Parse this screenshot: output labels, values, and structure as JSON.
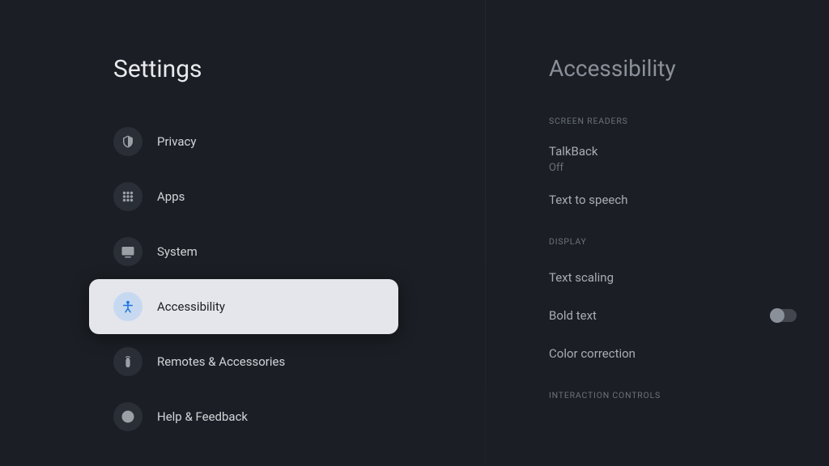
{
  "sidebar": {
    "title": "Settings",
    "items": [
      {
        "label": "Privacy",
        "icon": "shield",
        "selected": false
      },
      {
        "label": "Apps",
        "icon": "grid",
        "selected": false
      },
      {
        "label": "System",
        "icon": "monitor",
        "selected": false
      },
      {
        "label": "Accessibility",
        "icon": "accessibility",
        "selected": true
      },
      {
        "label": "Remotes & Accessories",
        "icon": "remote",
        "selected": false
      },
      {
        "label": "Help & Feedback",
        "icon": "help",
        "selected": false
      }
    ]
  },
  "panel": {
    "title": "Accessibility",
    "sections": [
      {
        "header": "SCREEN READERS",
        "items": [
          {
            "label": "TalkBack",
            "sublabel": "Off",
            "type": "link"
          },
          {
            "label": "Text to speech",
            "type": "link"
          }
        ]
      },
      {
        "header": "DISPLAY",
        "items": [
          {
            "label": "Text scaling",
            "type": "link"
          },
          {
            "label": "Bold text",
            "type": "toggle",
            "value": false
          },
          {
            "label": "Color correction",
            "type": "link"
          }
        ]
      },
      {
        "header": "INTERACTION CONTROLS",
        "items": []
      }
    ]
  }
}
